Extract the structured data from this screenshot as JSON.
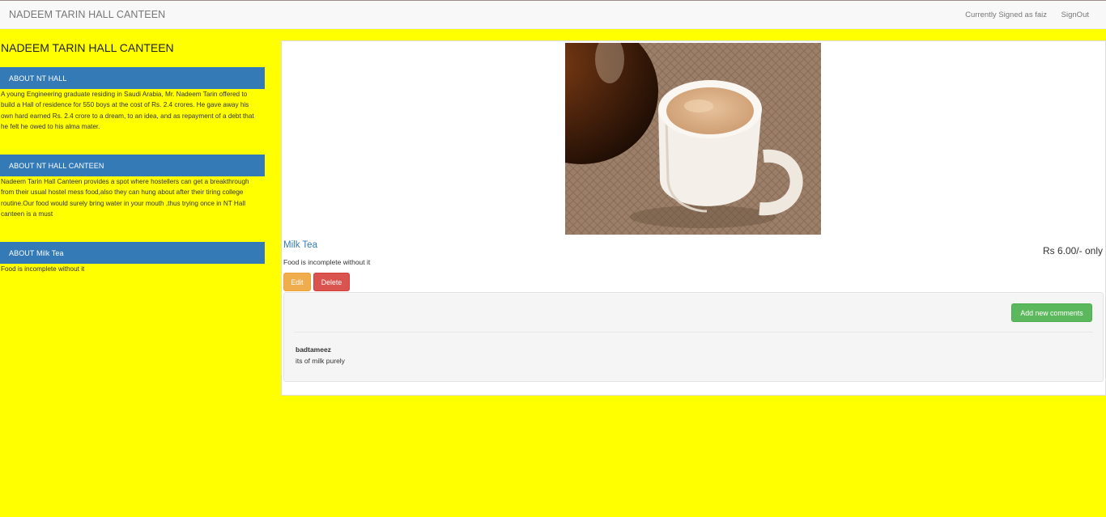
{
  "navbar": {
    "brand": "NADEEM TARIN HALL CANTEEN",
    "signed_in_text": "Currently Signed as faiz",
    "signout_label": "SignOut"
  },
  "sidebar": {
    "title": "NADEEM TARIN HALL CANTEEN",
    "sections": [
      {
        "heading": "ABOUT NT HALL",
        "text": "A young Engineering graduate residing in Saudi Arabia, Mr. Nadeem Tarin offered to build a Hall of residence for 550 boys at the cost of Rs. 2.4 crores. He gave away his own hard earned Rs. 2.4 crore to a dream, to an idea, and as repayment of a debt that he felt he owed to his alma mater."
      },
      {
        "heading": "ABOUT NT HALL CANTEEN",
        "text": "Nadeem Tarin Hall Canteen provides a spot where hostellers can get a breakthrough from their usual hostel mess food,also they can hung about after their tiring college routine.Our food would surely bring water in your mouth ,thus trying once in NT Hall canteen is a must"
      },
      {
        "heading": "ABOUT Milk Tea",
        "text": "Food is incomplete without it"
      }
    ]
  },
  "item": {
    "name": "Milk Tea",
    "price": "Rs 6.00/- only",
    "description": "Food is incomplete without it",
    "edit_label": "Edit",
    "delete_label": "Delete",
    "image_icon": "milk-tea-photo"
  },
  "comments": {
    "add_label": "Add new comments",
    "list": [
      {
        "author": "badtameez",
        "text": "its of milk purely"
      }
    ]
  },
  "colors": {
    "page_background": "#ffff00",
    "primary": "#337ab7",
    "warning": "#f0ad4e",
    "danger": "#d9534f",
    "success": "#5cb85c"
  }
}
